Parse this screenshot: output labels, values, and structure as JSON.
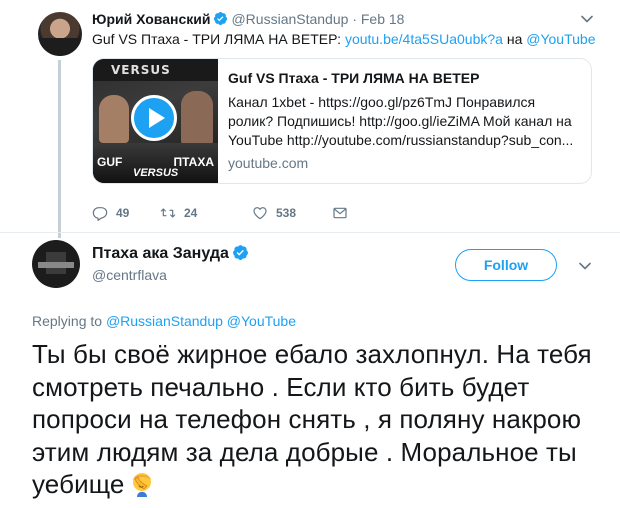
{
  "parent_tweet": {
    "author_name": "Юрий Хованский",
    "handle": "@RussianStandup",
    "separator": "·",
    "date": "Feb 18",
    "text_prefix": "Guf VS Птаха - ТРИ ЛЯМА НА ВЕТЕР: ",
    "link": "youtu.be/4ta5SUa0ubk?a",
    "text_mid": " на ",
    "mention": "@YouTube",
    "card": {
      "thumb_top": "VERSUS",
      "thumb_left": "GUF",
      "thumb_right": "ПТАХА",
      "thumb_bottom": "VERSUS",
      "title": "Guf VS Птаха - ТРИ ЛЯМА НА ВЕТЕР",
      "description": "Канал 1xbet - https://goo.gl/pz6TmJ Понравился ролик? Подпишись! http://goo.gl/ieZiMA Мой канал на YouTube http://youtube.com/russianstandup?sub_con...",
      "domain": "youtube.com"
    },
    "actions": {
      "replies": "49",
      "retweets": "24",
      "likes": "538"
    }
  },
  "main_tweet": {
    "author_name": "Птаха ака Зануда",
    "handle": "@centrflava",
    "follow_label": "Follow",
    "replying_prefix": "Replying to ",
    "replying_to_1": "@RussianStandup",
    "replying_to_2": "@YouTube",
    "text": "Ты бы своё жирное ебало захлопнул. На тебя смотреть печально . Если кто бить будет попроси на телефон снять , я поляну накрою  этим людям за дела добрые . Моральное ты уебище",
    "emoji": "facepalm-emoji"
  },
  "colors": {
    "accent": "#1da1f2",
    "secondary_text": "#657786",
    "primary_text": "#14171a",
    "border": "#e1e8ed"
  }
}
